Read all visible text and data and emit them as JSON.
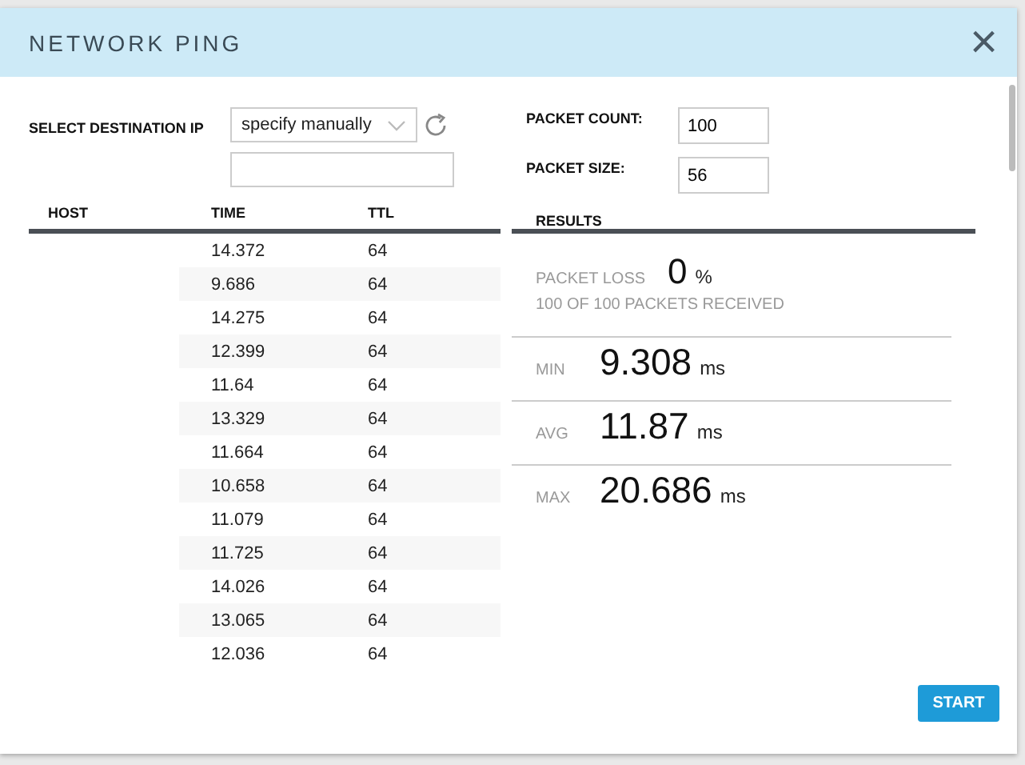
{
  "dialog": {
    "title": "NETWORK PING",
    "close": "×"
  },
  "destination": {
    "label": "SELECT DESTINATION IP",
    "select_value": "specify manually"
  },
  "packet_count": {
    "label": "PACKET COUNT:",
    "value": "100"
  },
  "packet_size": {
    "label": "PACKET SIZE:",
    "value": "56"
  },
  "table": {
    "columns": [
      "HOST",
      "TIME",
      "TTL"
    ],
    "rows": [
      {
        "time": "14.372",
        "ttl": "64"
      },
      {
        "time": "9.686",
        "ttl": "64"
      },
      {
        "time": "14.275",
        "ttl": "64"
      },
      {
        "time": "12.399",
        "ttl": "64"
      },
      {
        "time": "11.64",
        "ttl": "64"
      },
      {
        "time": "13.329",
        "ttl": "64"
      },
      {
        "time": "11.664",
        "ttl": "64"
      },
      {
        "time": "10.658",
        "ttl": "64"
      },
      {
        "time": "11.079",
        "ttl": "64"
      },
      {
        "time": "11.725",
        "ttl": "64"
      },
      {
        "time": "14.026",
        "ttl": "64"
      },
      {
        "time": "13.065",
        "ttl": "64"
      },
      {
        "time": "12.036",
        "ttl": "64"
      }
    ]
  },
  "results": {
    "title": "RESULTS",
    "loss_label": "PACKET LOSS",
    "loss_value": "0",
    "loss_unit": "%",
    "received": "100 OF 100 PACKETS RECEIVED",
    "stats": [
      {
        "label": "MIN",
        "value": "9.308",
        "unit": "ms"
      },
      {
        "label": "AVG",
        "value": "11.87",
        "unit": "ms"
      },
      {
        "label": "MAX",
        "value": "20.686",
        "unit": "ms"
      }
    ]
  },
  "buttons": [
    "START"
  ]
}
